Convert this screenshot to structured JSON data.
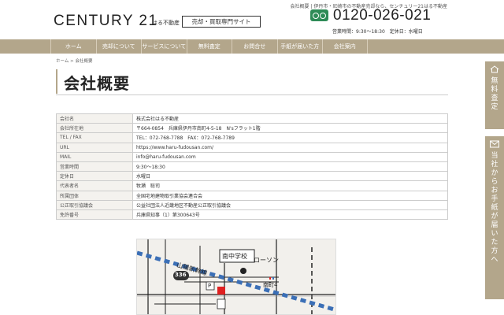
{
  "header": {
    "tagline": "会社概要 | 伊丹市・尼崎市の不動産売却なら、センチュリー21はる不動産",
    "logo_text": "CENTURY 21",
    "logo_sub": "はる不動産",
    "site_badge": "売却・買取専門サイト",
    "phone": "0120-026-021",
    "hours": "営業時間：9:30〜18:30　定休日：水曜日",
    "accent_color": "#b3a68b",
    "freedial_color": "#2e8b57"
  },
  "nav": {
    "items": [
      {
        "label": "ホーム"
      },
      {
        "label": "売却について"
      },
      {
        "label": "サービスについて"
      },
      {
        "label": "無料査定"
      },
      {
        "label": "お問合せ"
      },
      {
        "label": "手紙が届いた方"
      },
      {
        "label": "会社案内"
      }
    ]
  },
  "breadcrumb": "ホーム > 会社概要",
  "page_title": "会社概要",
  "company_table": {
    "rows": [
      {
        "label": "会社名",
        "value": "株式会社はる不動産"
      },
      {
        "label": "会社所在地",
        "value": "〒664-0854　兵庫県伊丹市南町4-5-18　N'sフラット1階"
      },
      {
        "label": "TEL / FAX",
        "value": "TEL：072-768-7788　FAX：072-768-7789"
      },
      {
        "label": "URL",
        "value": "https://www.haru-fudousan.com/"
      },
      {
        "label": "MAIL",
        "value": "info@haru-fudousan.com"
      },
      {
        "label": "営業時間",
        "value": "9:30〜18:30"
      },
      {
        "label": "定休日",
        "value": "水曜日"
      },
      {
        "label": "代表者名",
        "value": "牧瀬　聡司"
      },
      {
        "label": "所属団体",
        "value": "全国宅地建物取引業協会連合会"
      },
      {
        "label": "公正取引協議会",
        "value": "公益社団法人近畿地区不動産公正取引協議会"
      },
      {
        "label": "免許番号",
        "value": "兵庫県知事（1）第300643号"
      }
    ]
  },
  "map": {
    "school_label": "南中学校",
    "railway_label": "山陽新幹線",
    "store_label": "ローソン",
    "route_label": "336",
    "parking_label": "P",
    "area_label": "南町4",
    "marker_color": "#e02020",
    "railway_color": "#3b6fb6"
  },
  "side_tabs": {
    "free_label": "無料査定",
    "letter_label": "当社からお手紙が届いた方へ"
  }
}
